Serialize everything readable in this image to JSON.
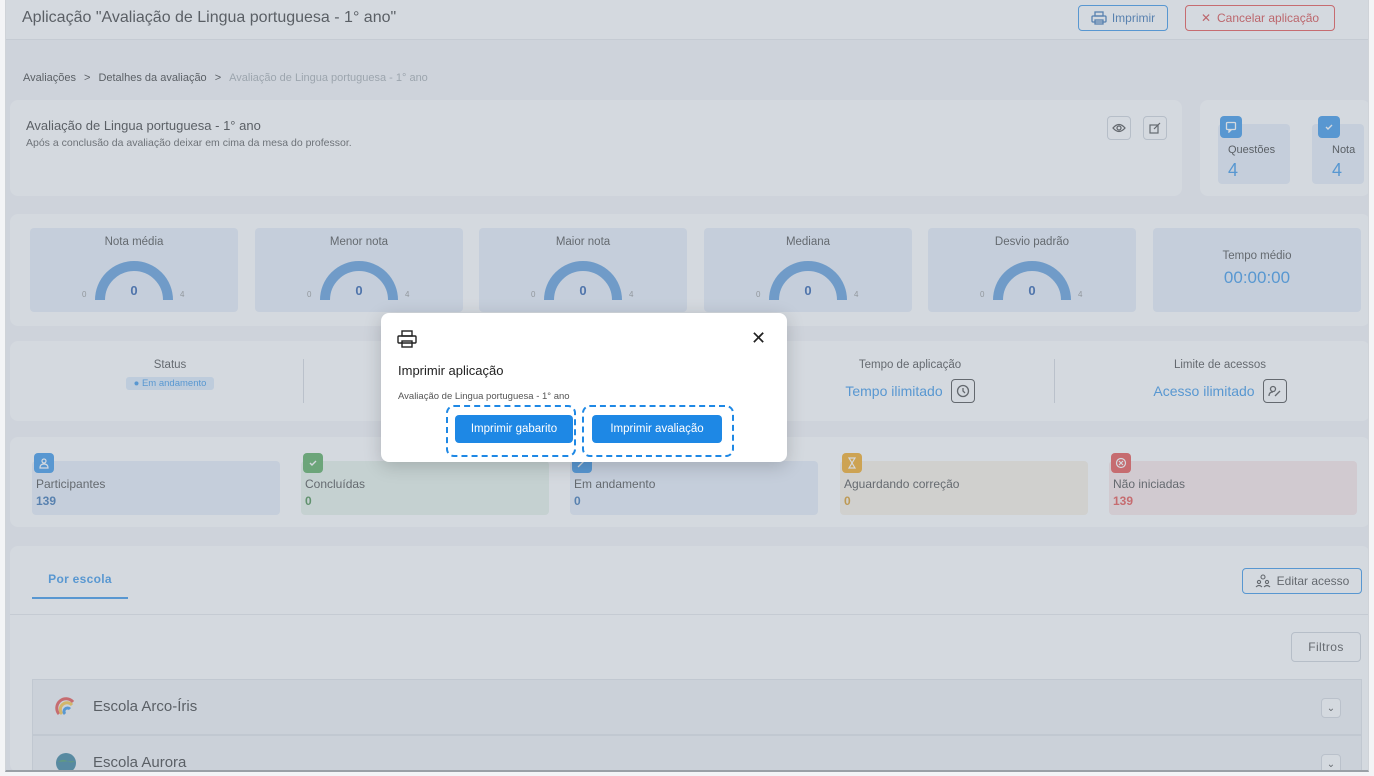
{
  "app": {
    "title": "Aplicação \"Avaliação de Lingua portuguesa - 1° ano\"",
    "print_label": "Imprimir",
    "cancel_label": "Cancelar aplicação"
  },
  "breadcrumb": {
    "items": [
      "Avaliações",
      "Detalhes da avaliação",
      "Avaliação de Lingua portuguesa - 1° ano"
    ],
    "separator": ">"
  },
  "assessment": {
    "title": "Avaliação de Lingua portuguesa - 1° ano",
    "description": "Após a conclusão da avaliação deixar em cima da mesa do professor."
  },
  "counts": {
    "questions_label": "Questões",
    "questions_value": "4",
    "grade_label": "Nota",
    "grade_value": "4"
  },
  "stats": [
    {
      "label": "Nota média",
      "value": "0",
      "min": "0",
      "max": "4"
    },
    {
      "label": "Menor nota",
      "value": "0",
      "min": "0",
      "max": "4"
    },
    {
      "label": "Maior nota",
      "value": "0",
      "min": "0",
      "max": "4"
    },
    {
      "label": "Mediana",
      "value": "0",
      "min": "0",
      "max": "4"
    },
    {
      "label": "Desvio padrão",
      "value": "0",
      "min": "0",
      "max": "4"
    }
  ],
  "time": {
    "label": "Tempo médio",
    "value": "00:00:00"
  },
  "status": {
    "status_label": "Status",
    "status_value": "Em andamento",
    "time_label": "Tempo de aplicação",
    "time_value": "Tempo ilimitado",
    "access_label": "Limite de acessos",
    "access_value": "Acesso ilimitado"
  },
  "participants": [
    {
      "label": "Participantes",
      "value": "139",
      "color": "#1e5fa8",
      "bg": "#e3ecf7",
      "badge": "#1e88e5"
    },
    {
      "label": "Concluídas",
      "value": "0",
      "color": "#2e7d32",
      "bg": "#e3f1e6",
      "badge": "#43a047"
    },
    {
      "label": "Em andamento",
      "value": "0",
      "color": "#1e5fa8",
      "bg": "#e3ecf7",
      "badge": "#1e88e5"
    },
    {
      "label": "Aguardando correção",
      "value": "0",
      "color": "#d68a00",
      "bg": "#f7efe0",
      "badge": "#f29d00"
    },
    {
      "label": "Não iniciadas",
      "value": "139",
      "color": "#e53935",
      "bg": "#f9e3e3",
      "badge": "#e53935"
    }
  ],
  "tabs": {
    "active": "Por escola",
    "edit_access": "Editar acesso",
    "filters": "Filtros"
  },
  "schools": [
    {
      "name": "Escola Arco-Íris"
    },
    {
      "name": "Escola Aurora"
    }
  ],
  "modal": {
    "title": "Imprimir aplicação",
    "subtitle": "Avaliação de Lingua portuguesa - 1° ano",
    "btn_answer_key": "Imprimir gabarito",
    "btn_assessment": "Imprimir avaliação"
  }
}
